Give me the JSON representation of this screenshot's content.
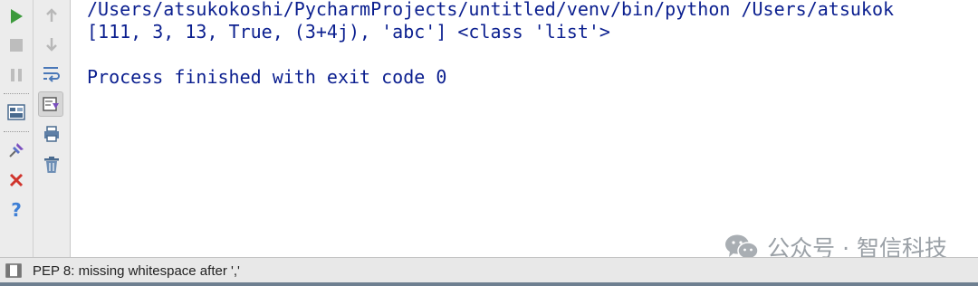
{
  "console": {
    "line1": "/Users/atsukokoshi/PycharmProjects/untitled/venv/bin/python /Users/atsukok",
    "line2": "[111, 3, 13, True, (3+4j), 'abc'] <class 'list'>",
    "line3": "Process finished with exit code 0"
  },
  "watermark": {
    "text": "公众号 · 智信科技"
  },
  "statusbar": {
    "message": "PEP 8: missing whitespace after ','"
  },
  "icons": {
    "left_toolbar": [
      "run-icon",
      "stop-icon",
      "pause-icon",
      "layout-icon",
      "pin-icon",
      "close-icon",
      "help-icon"
    ],
    "right_toolbar": [
      "up-arrow-icon",
      "down-arrow-icon",
      "soft-wrap-icon",
      "scroll-to-end-icon",
      "print-icon",
      "trash-icon"
    ]
  },
  "colors": {
    "console_text": "#0b1f8f",
    "run_green": "#3c9a3c",
    "close_red": "#d0342c",
    "help_blue": "#3d7fd6"
  }
}
